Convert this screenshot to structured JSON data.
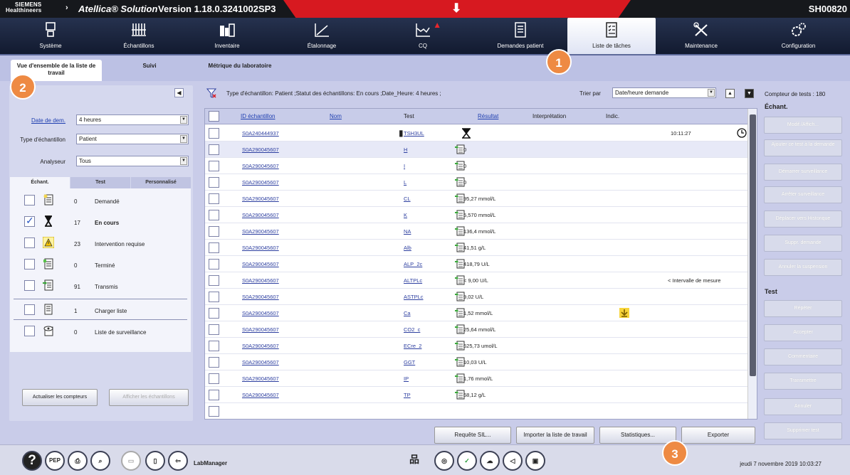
{
  "titlebar": {
    "brand": "SIEMENS Healthineers",
    "app": "Atellica® Solution",
    "version": "Version 1.18.0.3241002SP3",
    "host": "SH00820"
  },
  "nav": [
    {
      "label": "Système",
      "icon": "computer-icon"
    },
    {
      "label": "Échantillons",
      "icon": "sample-tubes-icon"
    },
    {
      "label": "Inventaire",
      "icon": "reagent-bottles-icon"
    },
    {
      "label": "Étalonnage",
      "icon": "calibration-curve-icon"
    },
    {
      "label": "CQ",
      "icon": "qc-icon"
    },
    {
      "label": "Demandes patient",
      "icon": "patient-orders-icon"
    },
    {
      "label": "Liste de tâches",
      "icon": "task-list-icon"
    },
    {
      "label": "Maintenance",
      "icon": "tools-icon"
    },
    {
      "label": "Configuration",
      "icon": "gears-icon"
    }
  ],
  "subtabs": [
    {
      "label": "Vue d'ensemble de la liste de travail"
    },
    {
      "label": "Suivi"
    },
    {
      "label": "Métrique du laboratoire"
    }
  ],
  "filters": {
    "date_label": "Date de dem.",
    "date_value": "4 heures",
    "type_label": "Type d'échantillon",
    "type_value": "Patient",
    "analyzer_label": "Analyseur",
    "analyzer_value": "Tous"
  },
  "category_tabs": [
    "Échant.",
    "Test",
    "Personnalisé"
  ],
  "categories": [
    {
      "count": "0",
      "label": "Demandé",
      "checked": false,
      "bold": false,
      "icon": "ordered-list-icon"
    },
    {
      "count": "17",
      "label": "En cours",
      "checked": true,
      "bold": true,
      "icon": "hourglass-icon"
    },
    {
      "count": "23",
      "label": "Intervention requise",
      "checked": false,
      "bold": false,
      "icon": "warning-icon"
    },
    {
      "count": "0",
      "label": "Terminé",
      "checked": false,
      "bold": false,
      "icon": "completed-list-icon"
    },
    {
      "count": "91",
      "label": "Transmis",
      "checked": false,
      "bold": false,
      "icon": "transmitted-list-icon"
    },
    {
      "count": "1",
      "label": "Charger liste",
      "checked": false,
      "bold": false,
      "icon": "load-list-icon"
    },
    {
      "count": "0",
      "label": "Liste de surveillance",
      "checked": false,
      "bold": false,
      "icon": "watchlist-icon"
    }
  ],
  "left_buttons": {
    "refresh": "Actualiser les compteurs",
    "show_samples": "Afficher les échantillons"
  },
  "filter_summary": "Type d'échantillon: Patient ;Statut des échantillons: En cours ;Date_Heure: 4 heures ;",
  "sort": {
    "label": "Trier par",
    "value": "Date/heure demande"
  },
  "table": {
    "headers": [
      "ID échantillon",
      "Nom",
      "Test",
      "Résultat",
      "Interprétation",
      "Indic."
    ],
    "rows": [
      {
        "id": "S0A240444937",
        "test": "TSH3UL",
        "result": "",
        "interp": "",
        "time": "10:11:27",
        "kind": "pending"
      },
      {
        "id": "S0A290045607",
        "test": "H",
        "result": "0",
        "interp": "",
        "time": "",
        "kind": "result"
      },
      {
        "id": "S0A290045607",
        "test": "I",
        "result": "0",
        "interp": "",
        "time": "",
        "kind": "result"
      },
      {
        "id": "S0A290045607",
        "test": "L",
        "result": "0",
        "interp": "",
        "time": "",
        "kind": "result"
      },
      {
        "id": "S0A290045607",
        "test": "CL",
        "result": "95,27 mmol/L",
        "interp": "",
        "time": "",
        "kind": "result"
      },
      {
        "id": "S0A290045607",
        "test": "K",
        "result": "5,570 mmol/L",
        "interp": "",
        "time": "",
        "kind": "result"
      },
      {
        "id": "S0A290045607",
        "test": "NA",
        "result": "136,4 mmol/L",
        "interp": "",
        "time": "",
        "kind": "result"
      },
      {
        "id": "S0A290045607",
        "test": "Alb",
        "result": "41,51 g/L",
        "interp": "",
        "time": "",
        "kind": "result"
      },
      {
        "id": "S0A290045607",
        "test": "ALP_2c",
        "result": "418,79 U/L",
        "interp": "",
        "time": "",
        "kind": "result"
      },
      {
        "id": "S0A290045607",
        "test": "ALTPLc",
        "result": "< 9,00 U/L",
        "interp": "< Intervalle de mesure",
        "time": "",
        "kind": "result"
      },
      {
        "id": "S0A290045607",
        "test": "ASTPLc",
        "result": "9,02 U/L",
        "interp": "",
        "time": "",
        "kind": "result"
      },
      {
        "id": "S0A290045607",
        "test": "Ca",
        "result": "1,52 mmol/L",
        "interp": "",
        "time": "",
        "kind": "flag"
      },
      {
        "id": "S0A290045607",
        "test": "CO2_c",
        "result": "25,64 mmol/L",
        "interp": "",
        "time": "",
        "kind": "result"
      },
      {
        "id": "S0A290045607",
        "test": "ECre_2",
        "result": "625,73 umol/L",
        "interp": "",
        "time": "",
        "kind": "result"
      },
      {
        "id": "S0A290045607",
        "test": "GGT",
        "result": "10,03 U/L",
        "interp": "",
        "time": "",
        "kind": "result"
      },
      {
        "id": "S0A290045607",
        "test": "IP",
        "result": "1,76 mmol/L",
        "interp": "",
        "time": "",
        "kind": "result"
      },
      {
        "id": "S0A290045607",
        "test": "TP",
        "result": "68,12 g/L",
        "interp": "",
        "time": "",
        "kind": "result"
      }
    ]
  },
  "bottom_buttons": [
    "Requête SIL...",
    "Importer la liste de travail",
    "Statistiques...",
    "Exporter"
  ],
  "right_panel": {
    "counter": "Compteur de tests : 180",
    "sample_title": "Échant.",
    "sample_buttons": [
      "Modif./Affich...",
      "Ajouter ce test à la demande",
      "Démarrer surveillance",
      "Arrêter surveillance",
      "Déplacer vers Historique",
      "Suppr. demande",
      "Annuler la suspension"
    ],
    "test_title": "Test",
    "test_buttons": [
      "Répéter",
      "Accepter",
      "Commentaire",
      "Transmettre",
      "Annuler",
      "Supprimer test"
    ]
  },
  "footer": {
    "labmanager": "LabManager",
    "datetime": "jeudi 7 novembre 2019 10:03:27",
    "pep": "PEP"
  },
  "callouts": [
    "1",
    "2",
    "3"
  ],
  "colors": {
    "accent_orange": "#ee8a43",
    "alert_red": "#d71920",
    "nav_dark": "#1c2540",
    "panel_lavender": "#c9cce9"
  }
}
